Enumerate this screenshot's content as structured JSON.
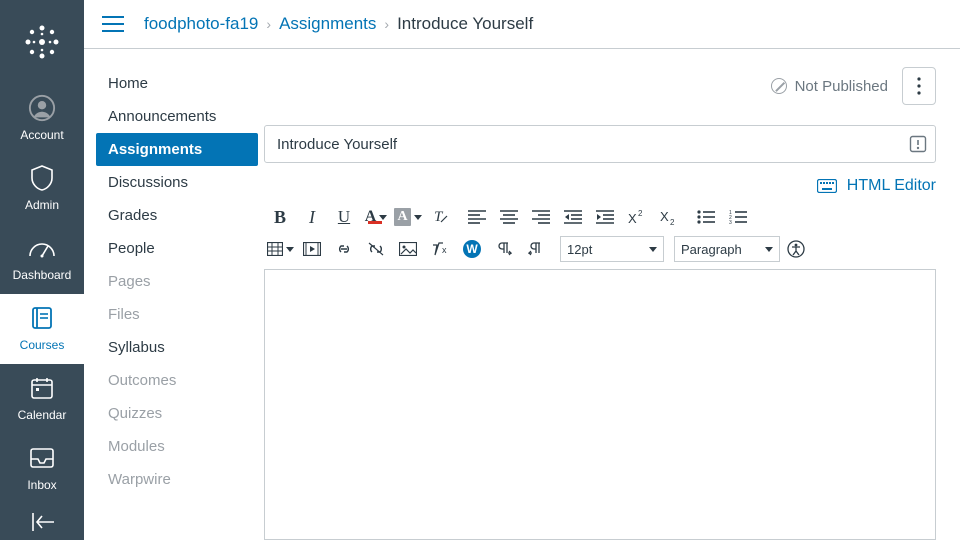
{
  "globalNav": {
    "items": [
      {
        "label": "Account"
      },
      {
        "label": "Admin"
      },
      {
        "label": "Dashboard"
      },
      {
        "label": "Courses"
      },
      {
        "label": "Calendar"
      },
      {
        "label": "Inbox"
      }
    ]
  },
  "breadcrumb": {
    "course": "foodphoto-fa19",
    "section": "Assignments",
    "current": "Introduce Yourself"
  },
  "courseNav": {
    "items": [
      {
        "label": "Home",
        "state": "plain"
      },
      {
        "label": "Announcements",
        "state": "plain"
      },
      {
        "label": "Assignments",
        "state": "active"
      },
      {
        "label": "Discussions",
        "state": "plain"
      },
      {
        "label": "Grades",
        "state": "plain"
      },
      {
        "label": "People",
        "state": "plain"
      },
      {
        "label": "Pages",
        "state": "muted"
      },
      {
        "label": "Files",
        "state": "muted"
      },
      {
        "label": "Syllabus",
        "state": "plain"
      },
      {
        "label": "Outcomes",
        "state": "muted"
      },
      {
        "label": "Quizzes",
        "state": "muted"
      },
      {
        "label": "Modules",
        "state": "muted"
      },
      {
        "label": "Warpwire",
        "state": "muted"
      }
    ]
  },
  "header": {
    "not_published": "Not Published"
  },
  "assignment": {
    "title": "Introduce Yourself"
  },
  "editor": {
    "html_editor_label": "HTML Editor",
    "font_size_value": "12pt",
    "paragraph_value": "Paragraph"
  }
}
